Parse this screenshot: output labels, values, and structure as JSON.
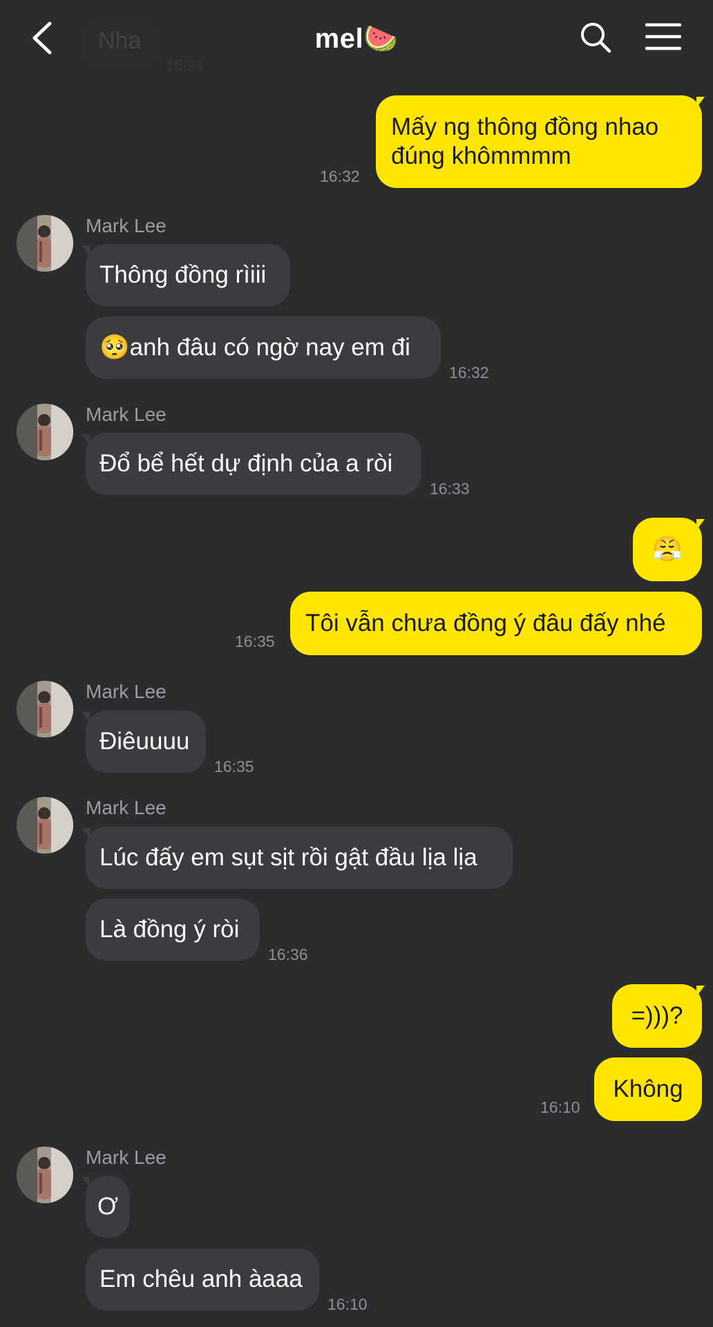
{
  "header": {
    "title": "mel🍉",
    "faded_preview_text": "Nha",
    "faded_preview_time": "16:24"
  },
  "colors": {
    "background": "#2b2c2e",
    "incoming_bubble": "#3b3c3f",
    "outgoing_bubble": "#ffe600"
  },
  "messages": [
    {
      "dir": "out",
      "text": "Mấy ng thông đồng nhao\nđúng khômmmm",
      "time": "16:32"
    },
    {
      "dir": "in",
      "sender": "Mark Lee",
      "text": "Thông đồng rìiii"
    },
    {
      "dir": "in",
      "emoji": "🥺",
      "text": "anh đâu có ngờ nay em đi",
      "time": "16:32"
    },
    {
      "dir": "in",
      "sender": "Mark Lee",
      "text": "Đổ bể hết dự định của a ròi",
      "time": "16:33"
    },
    {
      "dir": "out",
      "text": "😤"
    },
    {
      "dir": "out",
      "text": "Tôi vẫn chưa đồng ý đâu đấy nhé",
      "time": "16:35"
    },
    {
      "dir": "in",
      "sender": "Mark Lee",
      "text": "Điêuuuu",
      "time": "16:35"
    },
    {
      "dir": "in",
      "sender": "Mark Lee",
      "text": "Lúc đấy em sụt sịt rồi gật đầu lịa lịa"
    },
    {
      "dir": "in",
      "text": "Là đồng ý ròi",
      "time": "16:36"
    },
    {
      "dir": "out",
      "text": "=)))?"
    },
    {
      "dir": "out",
      "text": "Không",
      "time": "16:10"
    },
    {
      "dir": "in",
      "sender": "Mark Lee",
      "text": "Ơ"
    },
    {
      "dir": "in",
      "text": "Em chêu anh àaaa",
      "time": "16:10"
    }
  ]
}
